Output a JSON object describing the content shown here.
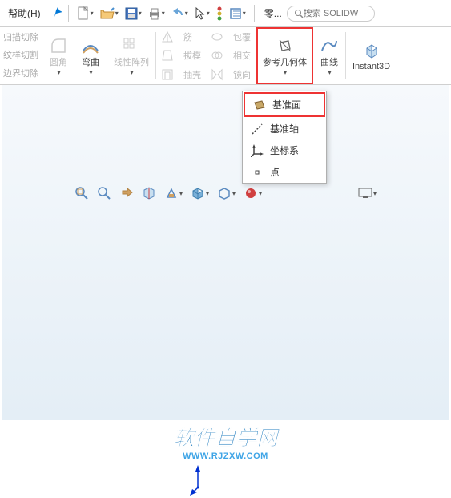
{
  "menubar": {
    "help_label": "帮助(H)",
    "part_label": "零...",
    "search_placeholder": "搜索 SOLIDW"
  },
  "ribbon": {
    "left_items": [
      "归描切除",
      "纹样切割",
      "边界切除"
    ],
    "fillet": "圆角",
    "bend": "弯曲",
    "linear_pattern": "线性阵列",
    "rib": "筋",
    "draft": "拔模",
    "shell": "抽壳",
    "wrap": "包覆",
    "intersect": "相交",
    "mirror": "镜向",
    "ref_geom": "参考几何体",
    "curve": "曲线",
    "instant3d": "Instant3D"
  },
  "ref_menu": {
    "items": [
      {
        "label": "基准面"
      },
      {
        "label": "基准轴"
      },
      {
        "label": "坐标系"
      },
      {
        "label": "点"
      }
    ]
  },
  "watermark": {
    "main": "软件自学网",
    "sub": "WWW.RJZXW.COM"
  }
}
